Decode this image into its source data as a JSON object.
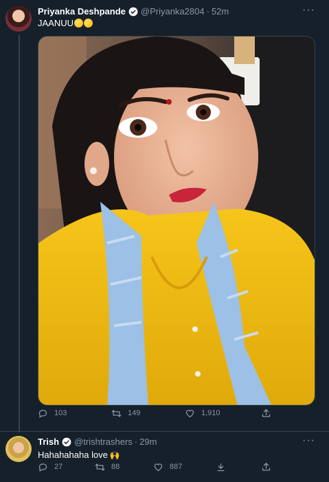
{
  "tweet1": {
    "name": "Priyanka Deshpande",
    "handle": "@Priyanka2804",
    "dot": "·",
    "time": "52m",
    "text": "JAANUU",
    "replies": "103",
    "retweets": "149",
    "likes": "1,910"
  },
  "tweet2": {
    "name": "Trish",
    "handle": "@trishtrashers",
    "dot": "·",
    "time": "29m",
    "text": "Hahahahaha love",
    "replies": "27",
    "retweets": "88",
    "likes": "887"
  },
  "icons": {
    "more": "···",
    "verified": "verified-badge-icon",
    "reply": "reply-icon",
    "retweet": "retweet-icon",
    "like": "heart-icon",
    "share": "share-icon",
    "download": "download-icon"
  },
  "colors": {
    "background": "#15202b",
    "muted": "#8899a6",
    "accent": "#1da1f2",
    "divider": "#38444d"
  }
}
